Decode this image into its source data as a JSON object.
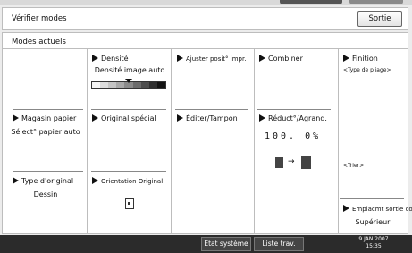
{
  "titlebar": {
    "title": "Vérifier modes",
    "exit_label": "Sortie"
  },
  "panel": {
    "heading": "Modes actuels"
  },
  "cells": {
    "densite": {
      "label": "Densité",
      "value": "Densité image auto"
    },
    "ajuster": {
      "label": "Ajuster posit° impr."
    },
    "combiner": {
      "label": "Combiner"
    },
    "finition": {
      "label": "Finition",
      "value": "<Type de pliage>"
    },
    "magasin": {
      "label": "Magasin papier",
      "value": "Sélect° papier auto"
    },
    "original_special": {
      "label": "Original spécial"
    },
    "editer": {
      "label": "Éditer/Tampon"
    },
    "reduct": {
      "label": "Réduct°/Agrand.",
      "value": "100. 0%"
    },
    "trier": {
      "value": "<Trier>"
    },
    "type_original": {
      "label": "Type d'original",
      "value": "Dessin"
    },
    "orientation": {
      "label": "Orientation Original"
    },
    "emplacement": {
      "label": "Emplacmt sortie cop.",
      "value": "Supérieur"
    }
  },
  "statusbar": {
    "etat_label": "Etat système",
    "liste_label": "Liste trav.",
    "date": "9  JAN  2007",
    "time": "15:35"
  }
}
